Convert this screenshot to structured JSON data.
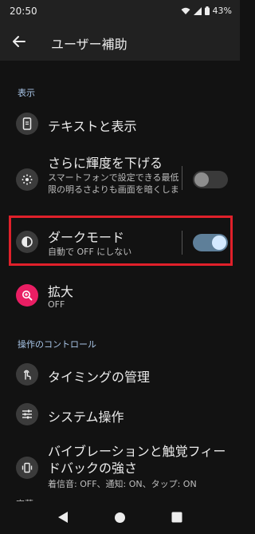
{
  "status": {
    "time": "20:50",
    "battery": "43%"
  },
  "appbar": {
    "title": "ユーザー補助"
  },
  "sections": {
    "display": "表示",
    "controls": "操作のコントロール"
  },
  "items": {
    "text_display": {
      "title": "テキストと表示"
    },
    "extra_dim": {
      "title": "さらに輝度を下げる",
      "subtitle": "スマートフォンで設定できる最低限の明るさよりも画面を暗くします",
      "toggle_on": false
    },
    "dark_mode": {
      "title": "ダークモード",
      "subtitle": "自動で OFF にしない",
      "toggle_on": true
    },
    "magnification": {
      "title": "拡大",
      "subtitle": "OFF"
    },
    "timing": {
      "title": "タイミングの管理"
    },
    "system": {
      "title": "システム操作"
    },
    "vibration": {
      "title": "バイブレーションと触覚フィードバックの強さ",
      "subtitle": "着信音: OFF、通知: ON、タップ: ON"
    }
  },
  "footer": {
    "caption": "字幕"
  },
  "colors": {
    "accent": "#A9C6E8",
    "highlight": "#E0202A",
    "magnify_icon_bg": "#E91E63",
    "toggle_on_track": "#5E7F99",
    "toggle_on_thumb": "#D3E9FF"
  },
  "icons": [
    "back-arrow-icon",
    "phone-text-icon",
    "brightness-icon",
    "contrast-icon",
    "magnify-icon",
    "touch-icon",
    "sliders-icon",
    "vibration-icon",
    "nav-back-icon",
    "nav-home-icon",
    "nav-recents-icon",
    "wifi-icon",
    "signal-icon",
    "battery-icon"
  ]
}
